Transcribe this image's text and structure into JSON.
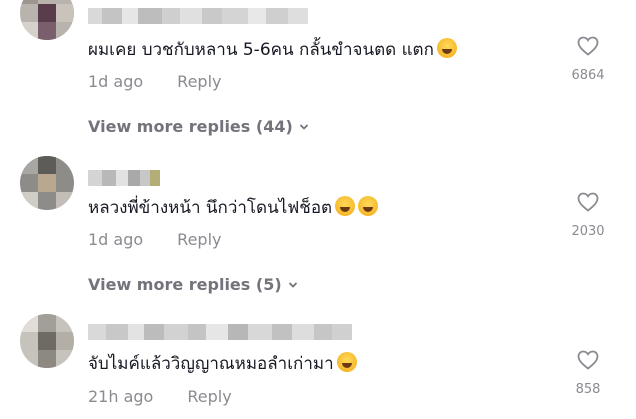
{
  "comments": [
    {
      "text": "ผมเคย บวชกับหลาน 5-6คน กลั้นขำจนตด แตก",
      "emojis": [
        "grinning-squinting-face"
      ],
      "time": "1d ago",
      "reply_label": "Reply",
      "likes": "6864",
      "view_more": "View more replies (44)"
    },
    {
      "text": "หลวงพี่ข้างหน้า นึกว่าโดนไฟช็อต",
      "emojis": [
        "grinning-squinting-face",
        "grinning-squinting-face"
      ],
      "time": "1d ago",
      "reply_label": "Reply",
      "likes": "2030",
      "view_more": "View more replies (5)"
    },
    {
      "text": "จับไมค์แล้ววิญญาณหมอลำเก่ามา",
      "emojis": [
        "grinning-sweat-face"
      ],
      "time": "21h ago",
      "reply_label": "Reply",
      "likes": "858"
    }
  ],
  "icons": {
    "like": "heart-outline-icon",
    "expand": "chevron-down-icon"
  },
  "colors": {
    "text": "#161823",
    "muted": "#8a8b91",
    "view_more": "#73747b"
  }
}
